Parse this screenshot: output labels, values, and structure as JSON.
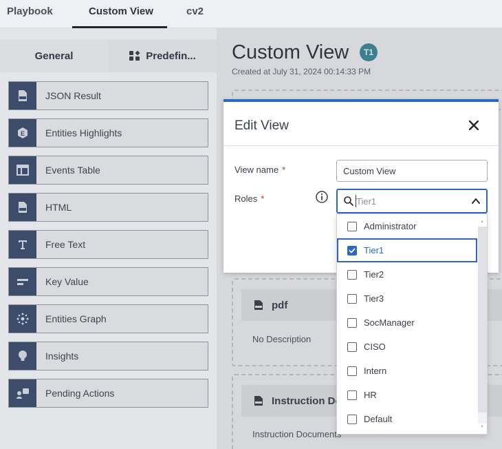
{
  "top_tabs": [
    {
      "label": "Playbook"
    },
    {
      "label": "Custom View",
      "active": true
    },
    {
      "label": "cv2"
    }
  ],
  "left_panel": {
    "tabs": [
      {
        "label": "General",
        "active": true
      },
      {
        "label": "Predefin..."
      }
    ],
    "widgets": [
      {
        "label": "JSON Result",
        "icon": "json-file-icon"
      },
      {
        "label": "Entities Highlights",
        "icon": "entity-hexagon-icon"
      },
      {
        "label": "Events Table",
        "icon": "table-icon"
      },
      {
        "label": "HTML",
        "icon": "html-file-icon"
      },
      {
        "label": "Free Text",
        "icon": "text-t-icon"
      },
      {
        "label": "Key Value",
        "icon": "key-value-icon"
      },
      {
        "label": "Entities Graph",
        "icon": "graph-icon"
      },
      {
        "label": "Insights",
        "icon": "lightbulb-icon"
      },
      {
        "label": "Pending Actions",
        "icon": "pending-actions-icon"
      }
    ]
  },
  "main": {
    "title": "Custom View",
    "avatar": "T1",
    "created": "Created at July 31, 2024 00:14:33 PM",
    "cards": [
      {
        "title": "pdf",
        "body": "No Description"
      },
      {
        "title": "Instruction Do",
        "body": "Instruction Documents"
      }
    ]
  },
  "modal": {
    "title": "Edit View",
    "view_name_label": "View name",
    "view_name_value": "Custom View",
    "roles_label": "Roles",
    "required_mark": "*",
    "roles_search_value": "Tier1"
  },
  "dropdown": {
    "options": [
      {
        "label": "Administrator",
        "checked": false
      },
      {
        "label": "Tier1",
        "checked": true
      },
      {
        "label": "Tier2",
        "checked": false
      },
      {
        "label": "Tier3",
        "checked": false
      },
      {
        "label": "SocManager",
        "checked": false
      },
      {
        "label": "CISO",
        "checked": false
      },
      {
        "label": "Intern",
        "checked": false
      },
      {
        "label": "HR",
        "checked": false
      },
      {
        "label": "Default",
        "checked": false
      }
    ]
  },
  "colors": {
    "accent": "#2a67c9",
    "widget_icon_bg": "#3c4c6a",
    "avatar_bg": "#3c7f8e",
    "required": "#d12c2c"
  }
}
